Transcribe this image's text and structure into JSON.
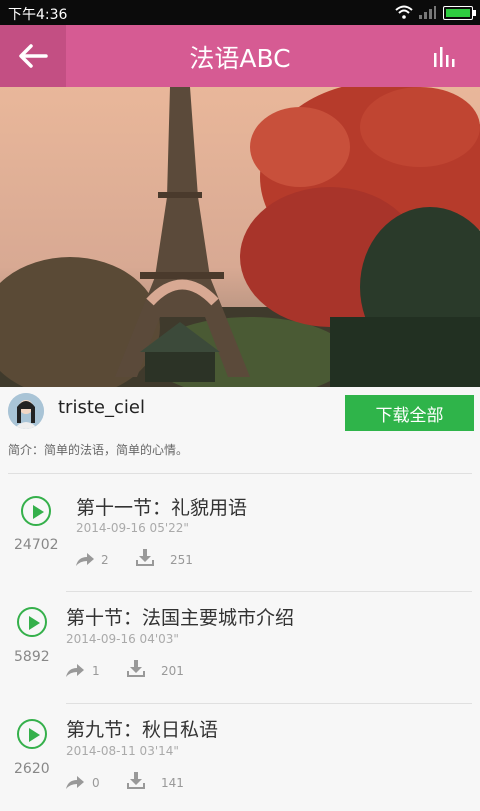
{
  "status": {
    "time": "下午4:36"
  },
  "appbar": {
    "title": "法语ABC"
  },
  "profile": {
    "username": "triste_ciel",
    "download_all": "下载全部",
    "intro": "简介：简单的法语，简单的心情。"
  },
  "episodes": [
    {
      "title": "第十一节：礼貌用语",
      "date": "2014-09-16  05'22\"",
      "plays": "24702",
      "shares": "2",
      "downloads": "251"
    },
    {
      "title": "第十节：法国主要城市介绍",
      "date": "2014-09-16  04'03\"",
      "plays": "5892",
      "shares": "1",
      "downloads": "201"
    },
    {
      "title": "第九节：秋日私语",
      "date": "2014-08-11  03'14\"",
      "plays": "2620",
      "shares": "0",
      "downloads": "141"
    }
  ],
  "colors": {
    "appbar": "#d65b93",
    "accent_green": "#35b04b",
    "button_green": "#2fb44a"
  }
}
